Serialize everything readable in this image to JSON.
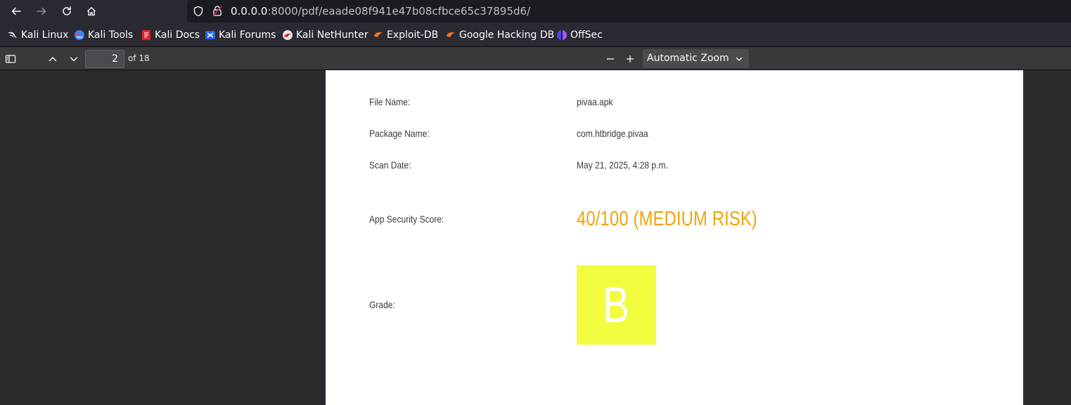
{
  "browser": {
    "url_host": "0.0.0.0",
    "url_rest": ":8000/pdf/eaade08f941e47b08cfbce65c37895d6/"
  },
  "bookmarks": [
    {
      "label": "Kali Linux",
      "icon": "kali-dragon-icon"
    },
    {
      "label": "Kali Tools",
      "icon": "kali-tools-icon"
    },
    {
      "label": "Kali Docs",
      "icon": "kali-docs-icon"
    },
    {
      "label": "Kali Forums",
      "icon": "kali-forums-icon"
    },
    {
      "label": "Kali NetHunter",
      "icon": "kali-nethunter-icon"
    },
    {
      "label": "Exploit-DB",
      "icon": "exploit-db-icon"
    },
    {
      "label": "Google Hacking DB",
      "icon": "ghdb-icon"
    },
    {
      "label": "OffSec",
      "icon": "offsec-icon"
    }
  ],
  "pdf_toolbar": {
    "page_number": "2",
    "page_count": "of 18",
    "zoom": "Automatic Zoom"
  },
  "report": {
    "file_name_label": "File Name:",
    "file_name": "pivaa.apk",
    "package_name_label": "Package Name:",
    "package_name": "com.htbridge.pivaa",
    "scan_date_label": "Scan Date:",
    "scan_date": "May 21, 2025, 4:28 p.m.",
    "score_label": "App Security Score:",
    "score": "40/100 (MEDIUM RISK)",
    "grade_label": "Grade:",
    "grade": "B"
  },
  "colors": {
    "score": "#f0a30a",
    "grade_bg": "#f2fc3f"
  }
}
